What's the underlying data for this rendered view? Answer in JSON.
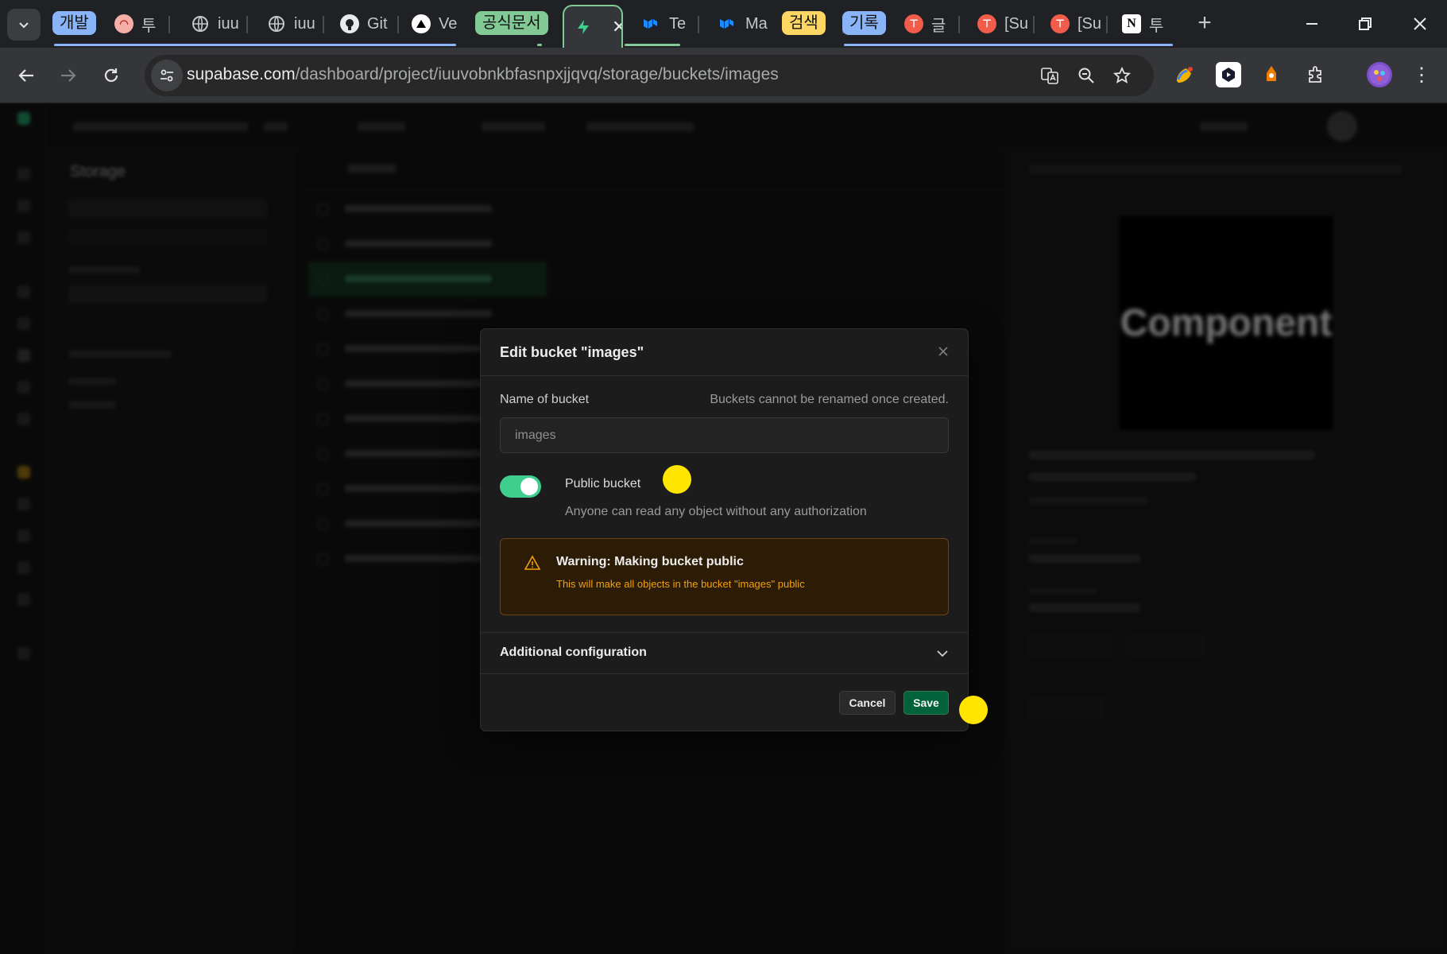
{
  "browser": {
    "tabs": [
      {
        "type": "group",
        "label": "개발",
        "color": "#8ab4f8"
      },
      {
        "type": "tab",
        "title": "투",
        "icon": "page-icon"
      },
      {
        "type": "tab",
        "title": "iuu",
        "icon": "globe-icon"
      },
      {
        "type": "tab",
        "title": "iuu",
        "icon": "globe-icon"
      },
      {
        "type": "tab",
        "title": "Git",
        "icon": "github-icon"
      },
      {
        "type": "tab",
        "title": "Ve",
        "icon": "vercel-icon"
      },
      {
        "type": "group",
        "label": "공식문서",
        "color": "#81c995"
      },
      {
        "type": "tab",
        "title": "",
        "icon": "supabase-icon",
        "active": true
      },
      {
        "type": "tab",
        "title": "Te",
        "icon": "mui-icon"
      },
      {
        "type": "tab",
        "title": "Ma",
        "icon": "mui-icon"
      },
      {
        "type": "group",
        "label": "검색",
        "color": "#fdd663"
      },
      {
        "type": "group",
        "label": "기록",
        "color": "#8ab4f8"
      },
      {
        "type": "tab",
        "title": "글",
        "icon": "red-circle-icon"
      },
      {
        "type": "tab",
        "title": "[Su",
        "icon": "red-circle-icon"
      },
      {
        "type": "tab",
        "title": "[Su",
        "icon": "red-circle-icon"
      },
      {
        "type": "tab",
        "title": "투",
        "icon": "notion-icon"
      }
    ],
    "url_host": "supabase.com",
    "url_path": "/dashboard/project/iuuvobnkbfasnpxjjqvq/storage/buckets/images"
  },
  "dashboard": {
    "sidebar_title": "Storage",
    "preview_text": "Component"
  },
  "modal": {
    "title": "Edit bucket \"images\"",
    "name_label": "Name of bucket",
    "name_hint": "Buckets cannot be renamed once created.",
    "name_value": "images",
    "public_label": "Public bucket",
    "public_desc": "Anyone can read any object without any authorization",
    "public_enabled": true,
    "warning_title": "Warning: Making bucket public",
    "warning_text": "This will make all objects in the bucket \"images\" public",
    "additional_label": "Additional configuration",
    "cancel_label": "Cancel",
    "save_label": "Save"
  },
  "colors": {
    "accent": "#3ecf8e",
    "save_button": "#006239",
    "warning_text": "#f1a10d",
    "marker": "#ffe500"
  }
}
